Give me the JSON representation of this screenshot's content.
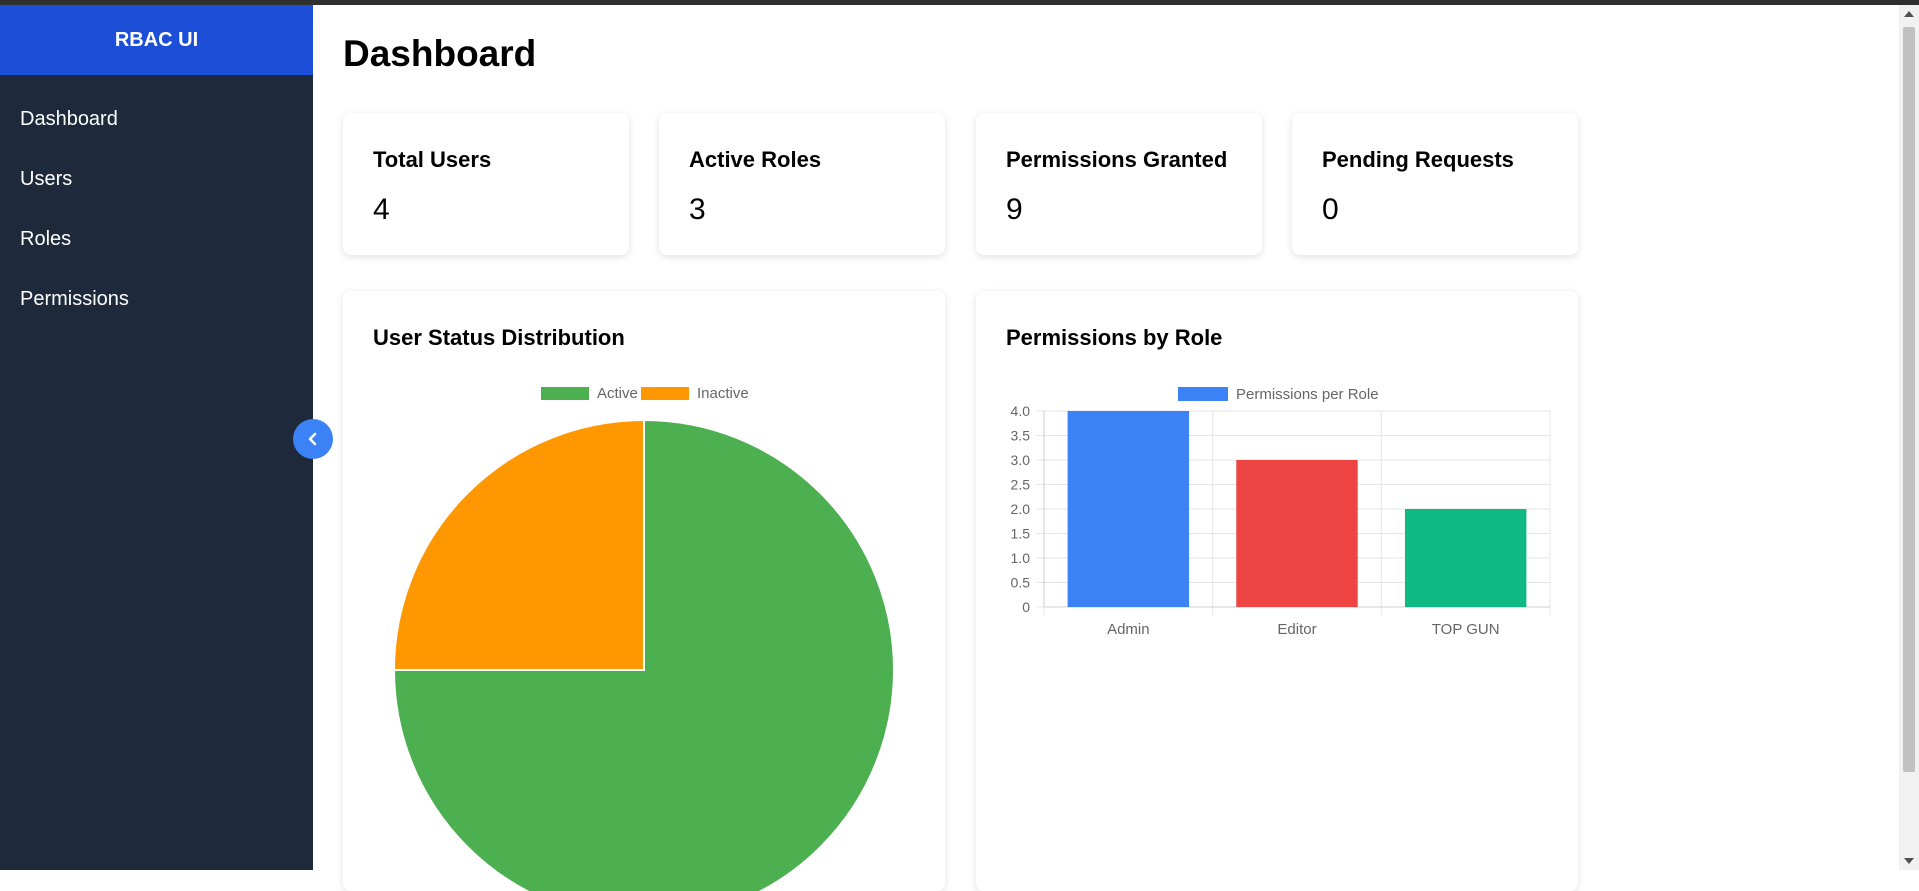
{
  "app": {
    "brand": "RBAC UI"
  },
  "sidebar": {
    "items": [
      {
        "label": "Dashboard"
      },
      {
        "label": "Users"
      },
      {
        "label": "Roles"
      },
      {
        "label": "Permissions"
      }
    ],
    "collapse_icon": "chevron-left-icon"
  },
  "page": {
    "title": "Dashboard"
  },
  "stats": [
    {
      "title": "Total Users",
      "value": "4"
    },
    {
      "title": "Active Roles",
      "value": "3"
    },
    {
      "title": "Permissions Granted",
      "value": "9"
    },
    {
      "title": "Pending Requests",
      "value": "0"
    }
  ],
  "colors": {
    "sidebar_bg": "#1e293b",
    "brand_bg": "#1d4ed8",
    "accent": "#3b82f6",
    "active": "#4caf50",
    "inactive": "#ff9800",
    "bar_admin": "#3b82f6",
    "bar_editor": "#ef4444",
    "bar_topgun": "#10b981"
  },
  "chart_data": [
    {
      "type": "pie",
      "title": "User Status Distribution",
      "categories": [
        "Active",
        "Inactive"
      ],
      "values": [
        3,
        1
      ],
      "colors": [
        "#4caf50",
        "#ff9800"
      ],
      "legend": "top-center"
    },
    {
      "type": "bar",
      "title": "Permissions by Role",
      "categories": [
        "Admin",
        "Editor",
        "TOP GUN"
      ],
      "series": [
        {
          "name": "Permissions per Role",
          "values": [
            4,
            3,
            2
          ]
        }
      ],
      "colors": [
        "#3b82f6",
        "#ef4444",
        "#10b981"
      ],
      "ylim": [
        0,
        4
      ],
      "yticks": [
        "4.0",
        "3.5",
        "3.0",
        "2.5",
        "2.0",
        "1.5",
        "1.0",
        "0.5",
        "0"
      ],
      "grid": true,
      "legend": "top-center"
    }
  ]
}
